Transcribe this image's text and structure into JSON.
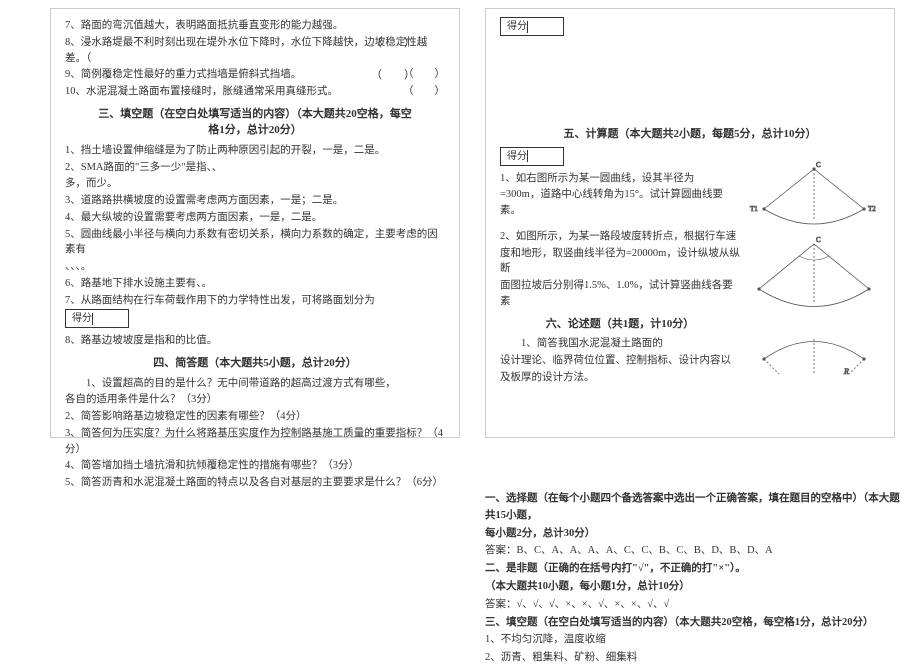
{
  "scoreLabel": "得分",
  "left": {
    "q7": "7、路面的弯沉值越大，表明路面抵抗垂直变形的能力越强。",
    "q8": "8、浸水路堤最不利时刻出现在堤外水位下降时，水位下降越快，边坡稳定性越差。（",
    "q9": "9、简例覆稳定性最好的重力式挡墙是俯斜式挡墙。",
    "q10": "10、水泥混凝土路面布置接缝时，胀缝通常采用真缝形式。",
    "tf1": "（　　）",
    "tf2": "（　　）",
    "tf3": "（　　）",
    "s3head1": "三、填空题（在空白处填写适当的内容）（本大题共20空格，每空",
    "s3head2": "格1分，总计20分）",
    "s3q1": "1、挡土墙设置伸缩缝是为了防止两种原因引起的开裂，一是，二是。",
    "s3q2": "2、SMA路面的\"三多一少\"是指、、",
    "s3q2b": "多，而少。",
    "s3q3": "3、道路路拱横坡度的设置需考虑两方面因素，一是；二是。",
    "s3q4": "4、最大纵坡的设置需要考虑两方面因素，一是，二是。",
    "s3q5": "5、圆曲线最小半径与横向力系数有密切关系，横向力系数的确定，主要考虑的因素有",
    "s3q5b": "、、、。",
    "s3q6": "6、路基地下排水设施主要有、。",
    "s3q7": "7、从路面结构在行车荷载作用下的力学特性出发，可将路面划分为",
    "s3q8": "8、路基边坡坡度是指和的比值。",
    "s4head": "四、简答题（本大题共5小题，总计20分）",
    "s4q1": "1、设置超高的目的是什么？无中间带道路的超高过渡方式有哪些，",
    "s4q1b": "各自的适用条件是什么？（3分）",
    "s4q2": "2、简答影响路基边坡稳定性的因素有哪些？（4分）",
    "s4q3": "3、简答何为压实度？为什么将路基压实度作为控制路基施工质量的重要指标？（4分）",
    "s4q4": "4、简答增加挡土墙抗滑和抗倾覆稳定性的措施有哪些？（3分）",
    "s4q5": "5、简答沥青和水泥混凝土路面的特点以及各自对基层的主要要求是什么？（6分）"
  },
  "right": {
    "s5head": "五、计算题（本大题共2小题，每题5分，总计10分）",
    "s5q1a": "1、如右图所示为某一圆曲线，设其半径为",
    "s5q1b": "=300m，道路中心线转角为15°。试计算圆曲线要素。",
    "s5q2a": "2、如图所示，为某一路段坡度转折点，根据行车速",
    "s5q2b": "度和地形，取竖曲线半径为=20000m，设计纵坡从纵断",
    "s5q2c": "面图拉坡后分别得1.5%、1.0%，试计算竖曲线各要素",
    "s6head": "六、论述题（共1题，计10分）",
    "s6q1a": "1、简答我国水泥混凝土路面的",
    "s6q1b": "设计理论、临界荷位位置、控制指标、设计内容以",
    "s6q1c": "及板厚的设计方法。"
  },
  "answers": {
    "a1head": "一、选择题（在每个小题四个备选答案中选出一个正确答案，填在题目的空格中）（本大题共15小题，",
    "a1head2": "每小题2分，总计30分）",
    "a1ans": "答案：B、C、A、A、A、A、C、C、B、C、B、D、B、D、A",
    "a2head": "二、是非题（正确的在括号内打\"√\"，不正确的打\"×\"）。",
    "a2head2": "（本大题共10小题，每小题1分，总计10分）",
    "a2ans": "答案：√、√、√、×、×、√、×、×、√、√",
    "a3head": "三、填空题（在空白处填写适当的内容）（本大题共20空格，每空格1分，总计20分）",
    "a3q1": "1、不均匀沉降，温度收缩",
    "a3q2": "2、沥青、粗集料、矿粉、细集料"
  }
}
